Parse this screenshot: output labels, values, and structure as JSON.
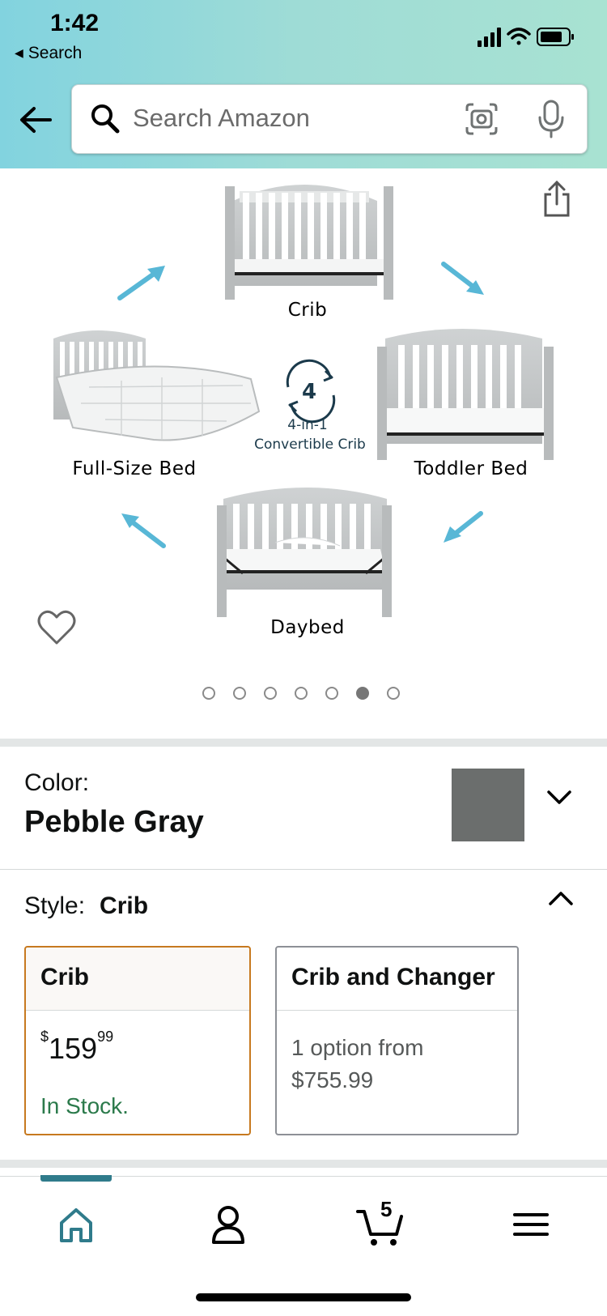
{
  "status_bar": {
    "time": "1:42",
    "back_label": "Search"
  },
  "search": {
    "placeholder": "Search Amazon"
  },
  "product_image": {
    "labels": {
      "crib": "Crib",
      "toddler_bed": "Toddler Bed",
      "daybed": "Daybed",
      "full_size_bed": "Full-Size Bed",
      "badge_number": "4",
      "badge_line1": "4-in-1",
      "badge_line2": "Convertible Crib"
    },
    "carousel": {
      "count": 7,
      "active_index": 5
    }
  },
  "color": {
    "label": "Color:",
    "value": "Pebble Gray",
    "swatch_color": "#6b6e6d"
  },
  "style": {
    "label": "Style:",
    "value": "Crib",
    "options": [
      {
        "name": "Crib",
        "price_symbol": "$",
        "price_whole": "159",
        "price_fraction": "99",
        "availability": "In Stock.",
        "selected": true
      },
      {
        "name": "Crib and Changer",
        "line1": "1 option from",
        "line2": "$755.99",
        "selected": false
      }
    ]
  },
  "bottom_nav": {
    "cart_count": "5",
    "accent_color": "#2f7b8b"
  },
  "colors": {
    "selected_border": "#c7791f",
    "in_stock": "#2b7a4b"
  }
}
